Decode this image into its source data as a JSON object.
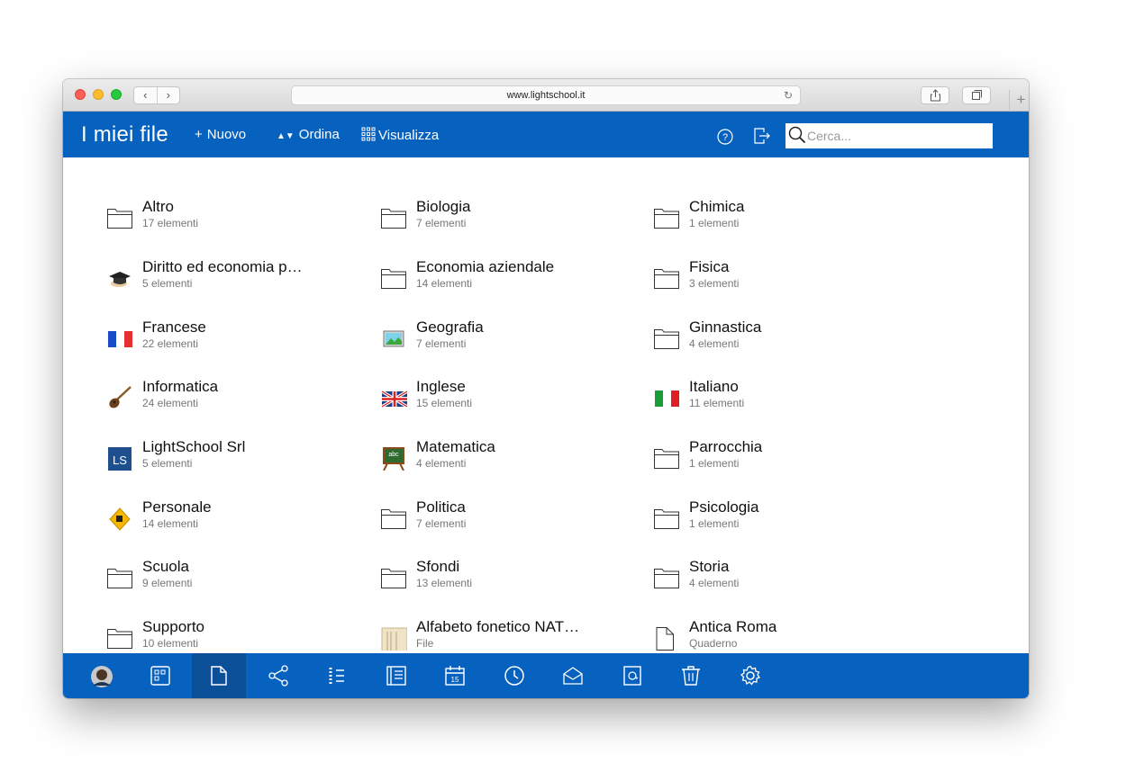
{
  "browser": {
    "url": "www.lightschool.it"
  },
  "app": {
    "title": "I miei file",
    "actions": {
      "new_label": "Nuovo",
      "sort_label": "Ordina",
      "view_label": "Visualizza"
    },
    "search_placeholder": "Cerca...",
    "accent_color": "#0761bf"
  },
  "items": [
    {
      "name": "Altro",
      "sub": "17 elementi",
      "icon": "folder-icon"
    },
    {
      "name": "Biologia",
      "sub": "7 elementi",
      "icon": "folder-icon"
    },
    {
      "name": "Chimica",
      "sub": "1 elementi",
      "icon": "folder-icon"
    },
    {
      "name": "Diritto ed economia p…",
      "sub": "5 elementi",
      "icon": "graduation-cap-icon"
    },
    {
      "name": "Economia aziendale",
      "sub": "14 elementi",
      "icon": "folder-icon"
    },
    {
      "name": "Fisica",
      "sub": "3 elementi",
      "icon": "folder-icon"
    },
    {
      "name": "Francese",
      "sub": "22 elementi",
      "icon": "french-flag-icon"
    },
    {
      "name": "Geografia",
      "sub": "7 elementi",
      "icon": "picture-icon"
    },
    {
      "name": "Ginnastica",
      "sub": "4 elementi",
      "icon": "folder-icon"
    },
    {
      "name": "Informatica",
      "sub": "24 elementi",
      "icon": "guitar-icon"
    },
    {
      "name": "Inglese",
      "sub": "15 elementi",
      "icon": "uk-flag-icon"
    },
    {
      "name": "Italiano",
      "sub": "11 elementi",
      "icon": "italian-flag-icon"
    },
    {
      "name": "LightSchool Srl",
      "sub": "5 elementi",
      "icon": "ls-logo-icon"
    },
    {
      "name": "Matematica",
      "sub": "4 elementi",
      "icon": "chalkboard-icon"
    },
    {
      "name": "Parrocchia",
      "sub": "1 elementi",
      "icon": "folder-icon"
    },
    {
      "name": "Personale",
      "sub": "14 elementi",
      "icon": "warning-sign-icon"
    },
    {
      "name": "Politica",
      "sub": "7 elementi",
      "icon": "folder-icon"
    },
    {
      "name": "Psicologia",
      "sub": "1 elementi",
      "icon": "folder-icon"
    },
    {
      "name": "Scuola",
      "sub": "9 elementi",
      "icon": "folder-icon"
    },
    {
      "name": "Sfondi",
      "sub": "13 elementi",
      "icon": "folder-icon"
    },
    {
      "name": "Storia",
      "sub": "4 elementi",
      "icon": "folder-icon"
    },
    {
      "name": "Supporto",
      "sub": "10 elementi",
      "icon": "folder-icon"
    },
    {
      "name": "Alfabeto fonetico NAT…",
      "sub": "File",
      "icon": "document-thumbnail-icon"
    },
    {
      "name": "Antica Roma",
      "sub": "Quaderno",
      "icon": "notebook-icon"
    }
  ],
  "bottom_nav": [
    {
      "icon": "user-avatar-icon"
    },
    {
      "icon": "desktop-icon"
    },
    {
      "icon": "file-icon",
      "active": true
    },
    {
      "icon": "share-icon"
    },
    {
      "icon": "register-list-icon"
    },
    {
      "icon": "diary-icon"
    },
    {
      "icon": "calendar-icon",
      "label": "15"
    },
    {
      "icon": "clock-icon"
    },
    {
      "icon": "message-icon"
    },
    {
      "icon": "contacts-icon"
    },
    {
      "icon": "trash-icon"
    },
    {
      "icon": "settings-icon"
    }
  ]
}
